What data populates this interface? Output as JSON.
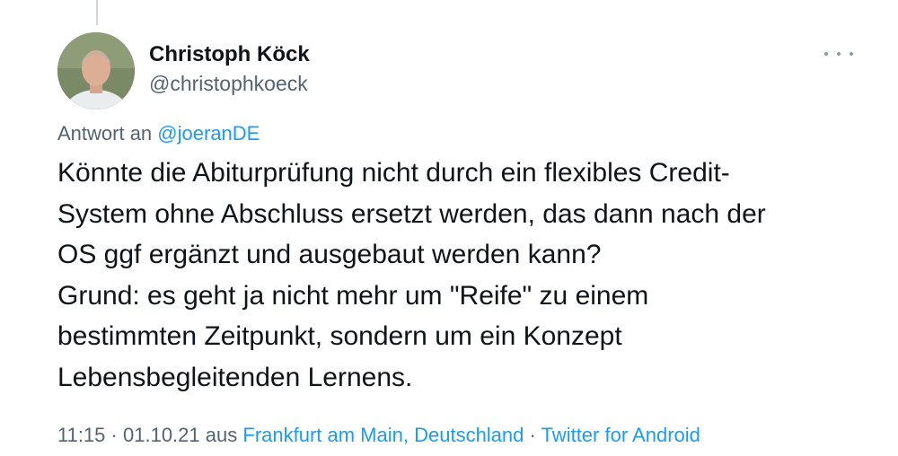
{
  "author": {
    "name": "Christoph Köck",
    "handle": "@christophkoeck"
  },
  "reply": {
    "prefix": "Antwort an",
    "mention": "@joeranDE"
  },
  "tweet": {
    "lines": [
      "Könnte die Abiturprüfung nicht durch ein flexibles Credit-",
      "System ohne Abschluss ersetzt werden, das dann nach der",
      "OS ggf ergänzt und ausgebaut werden kann?",
      "Grund: es geht ja nicht mehr um \"Reife\" zu einem",
      "bestimmten Zeitpunkt, sondern um ein Konzept",
      "Lebensbegleitenden Lernens."
    ]
  },
  "meta": {
    "time": "11:15",
    "sep1": "·",
    "date": "01.10.21",
    "location_prefix": "aus",
    "location": "Frankfurt am Main, Deutschland",
    "sep2": "·",
    "source": "Twitter for Android"
  },
  "icons": {
    "more": "more-horizontal-icon",
    "avatar": "profile-photo"
  },
  "colors": {
    "link": "#1d9bf0",
    "secondary_text": "#536471",
    "primary_text": "#0f1419"
  }
}
